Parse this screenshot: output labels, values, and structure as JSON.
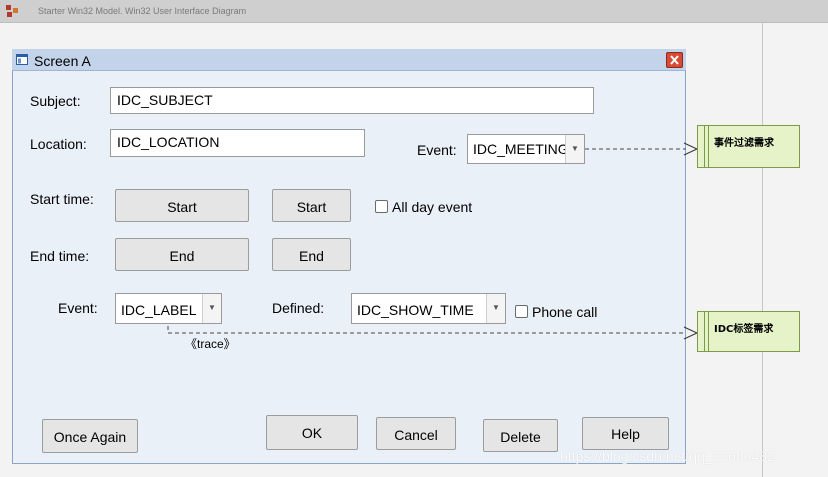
{
  "app": {
    "title": "Starter Win32 Model.  Win32 User Interface Diagram",
    "diagram_icon": "diagram-icon"
  },
  "window": {
    "title": "Screen A",
    "icon": "window-icon",
    "close_icon": "close-icon"
  },
  "form": {
    "subject_label": "Subject:",
    "subject_value": "IDC_SUBJECT",
    "location_label": "Location:",
    "location_value": "IDC_LOCATION",
    "event_label": "Event:",
    "event_value": "IDC_MEETING",
    "start_label": "Start time:",
    "start_btn1": "Start",
    "start_btn2": "Start",
    "allday_label": "All day event",
    "end_label": "End time:",
    "end_btn1": "End",
    "end_btn2": "End",
    "event2_label": "Event:",
    "event2_value": "IDC_LABEL",
    "defined_label": "Defined:",
    "defined_value": "IDC_SHOW_TIME",
    "phone_label": "Phone call",
    "trace_label": "《trace》"
  },
  "buttons": {
    "once_again": "Once Again",
    "ok": "OK",
    "cancel": "Cancel",
    "delete": "Delete",
    "help": "Help"
  },
  "notes": {
    "note1": "事件过滤需求",
    "note2": "IDC标签需求"
  },
  "watermark": "https://blog.csdn.net/qq_33680482",
  "colors": {
    "frame_border": "#8aa4c8",
    "titlebar": "#c3d4ea",
    "note_fill": "#e6f3c9",
    "note_border": "#7b9b48",
    "close_button": "#d64a36"
  }
}
